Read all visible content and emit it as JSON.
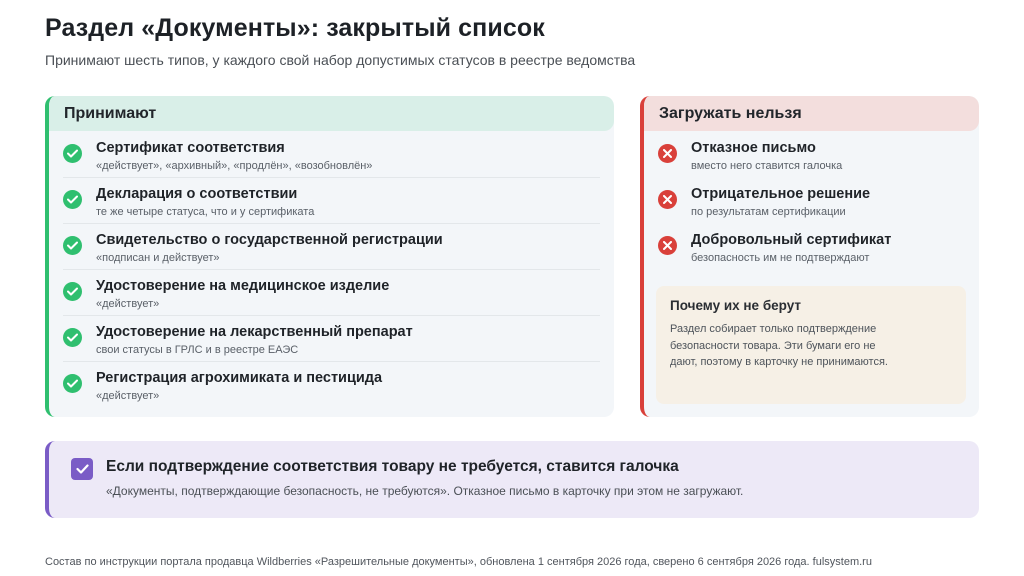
{
  "header": {
    "title": "Раздел «Документы»: закрытый список",
    "subtitle": "Принимают шесть типов, у каждого свой набор допустимых статусов в реестре ведомства"
  },
  "accept": {
    "heading": "Принимают",
    "accent_color": "#2fbf6f",
    "items": [
      {
        "title": "Сертификат соответствия",
        "note": "«действует», «архивный», «продлён», «возобновлён»"
      },
      {
        "title": "Декларация о соответствии",
        "note": "те же четыре статуса, что и у сертификата"
      },
      {
        "title": "Свидетельство о государственной регистрации",
        "note": "«подписан и действует»"
      },
      {
        "title": "Удостоверение на медицинское изделие",
        "note": "«действует»"
      },
      {
        "title": "Удостоверение на лекарственный препарат",
        "note": "свои статусы в ГРЛС и в реестре ЕАЭС"
      },
      {
        "title": "Регистрация агрохимиката и пестицида",
        "note": "«действует»"
      }
    ]
  },
  "reject": {
    "heading": "Загружать нельзя",
    "accent_color": "#d9403a",
    "items": [
      {
        "title": "Отказное письмо",
        "note": "вместо него ставится галочка"
      },
      {
        "title": "Отрицательное решение",
        "note": "по результатам сертификации"
      },
      {
        "title": "Добровольный сертификат",
        "note": "безопасность им не подтверждают"
      }
    ],
    "why": {
      "title": "Почему их не берут",
      "text": "Раздел собирает только подтверждение безопасности товара. Эти бумаги его не дают, поэтому в карточку не принимаются."
    }
  },
  "banner": {
    "title": "Если подтверждение соответствия товару не требуется, ставится галочка",
    "text": "«Документы, подтверждающие безопасность, не требуются». Отказное письмо в карточку при этом не загружают.",
    "accent_color": "#7a5cc6"
  },
  "footer": {
    "text": "Состав по инструкции портала продавца Wildberries «Разрешительные документы», обновлена 1 сентября 2026 года, сверено 6 сентября 2026 года. fulsystem.ru"
  }
}
